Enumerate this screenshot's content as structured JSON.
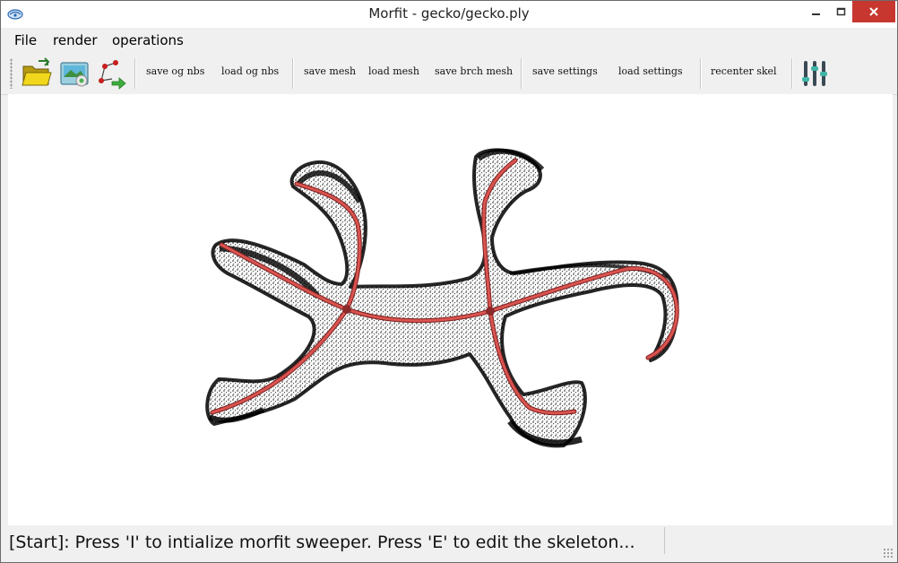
{
  "window": {
    "title": "Morfit - gecko/gecko.ply",
    "controls": [
      "minimize",
      "maximize",
      "close"
    ]
  },
  "menu": {
    "items": [
      {
        "label": "File"
      },
      {
        "label": "render"
      },
      {
        "label": "operations"
      }
    ]
  },
  "toolbar": {
    "icons": [
      "open-folder-icon",
      "load-image-icon",
      "skeleton-export-icon",
      "settings-sliders-icon"
    ],
    "buttons": [
      {
        "label": "save og nbs"
      },
      {
        "label": "load og nbs"
      },
      {
        "label": "save mesh"
      },
      {
        "label": "load mesh"
      },
      {
        "label": "save brch mesh"
      },
      {
        "label": "save settings"
      },
      {
        "label": "load settings"
      },
      {
        "label": "recenter skel"
      }
    ]
  },
  "viewport": {
    "point_color": "#000000",
    "skeleton_color": "#c8403e",
    "background": "#ffffff"
  },
  "status": {
    "message": "[Start]: Press 'I' to intialize morfit sweeper. Press 'E' to edit the skeleton..."
  }
}
